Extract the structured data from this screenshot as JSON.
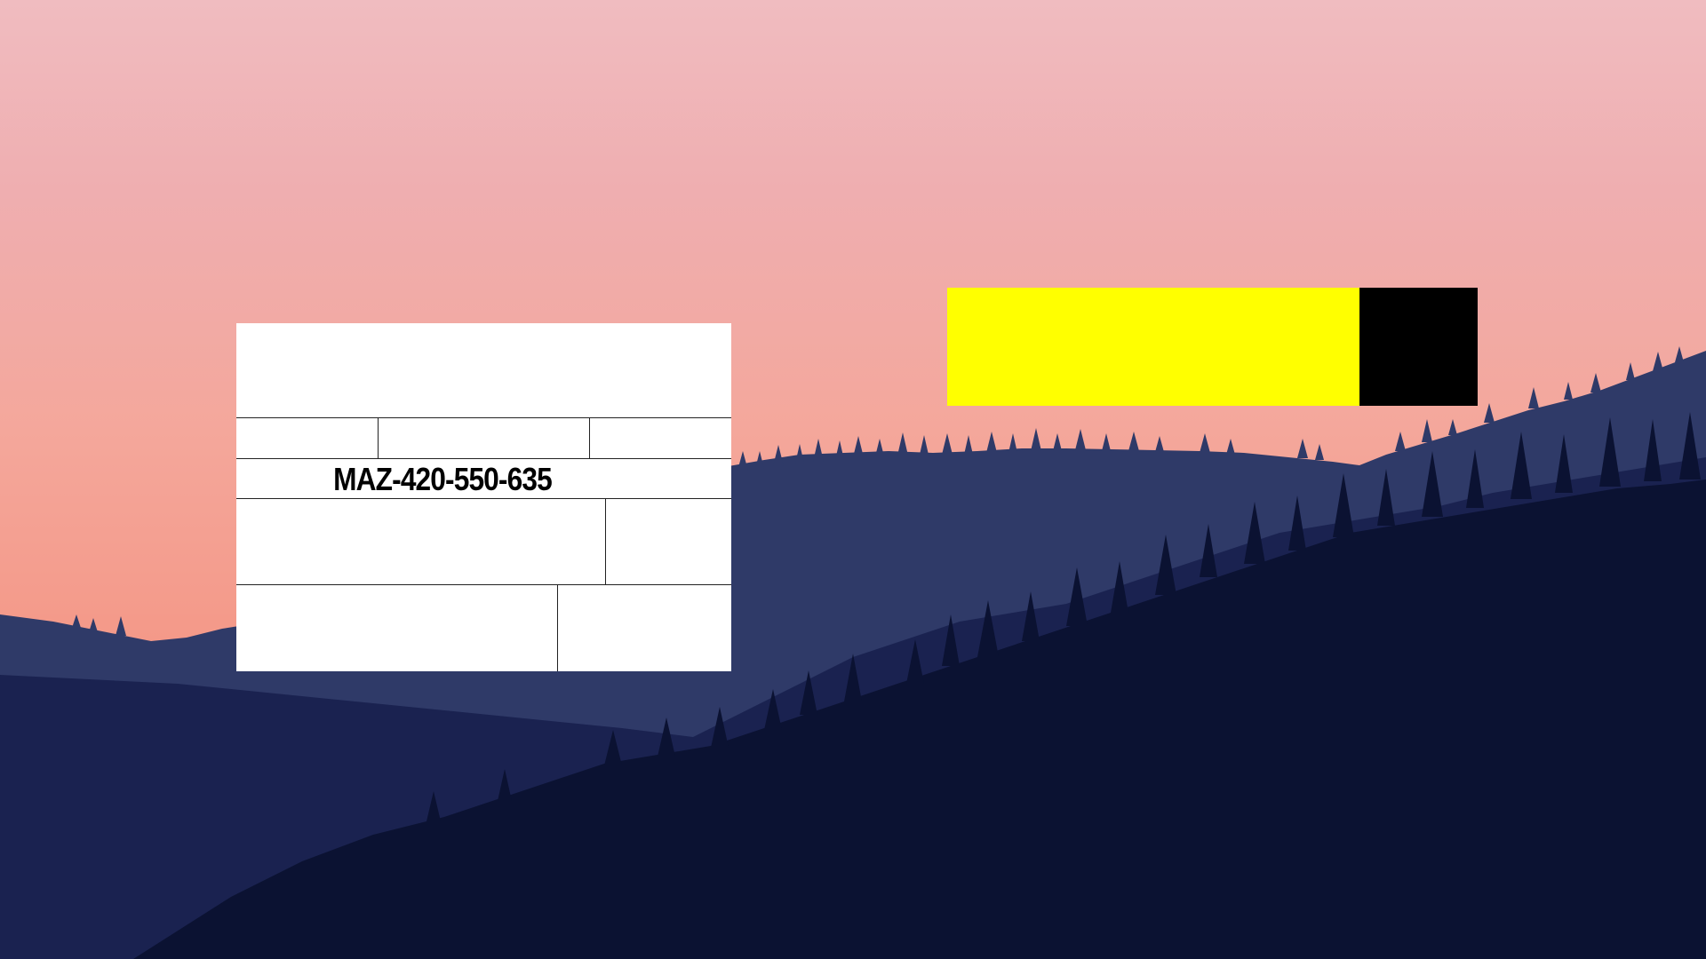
{
  "wallpaper": {
    "scene": "mountain-sunset-silhouette",
    "sky_top_color": "#f0bcc0",
    "sky_bottom_color": "#f29584",
    "far_ridge_color": "#2f3a68",
    "mid_ridge_color": "#1a2250",
    "near_forest_color": "#0b1232"
  },
  "label_card": {
    "code": "MAZ-420-550-635",
    "background_color": "#ffffff",
    "line_color": "#222222"
  },
  "indicator": {
    "fill_fraction": 0.777,
    "fill_color": "#ffff00",
    "rest_color": "#000000"
  }
}
